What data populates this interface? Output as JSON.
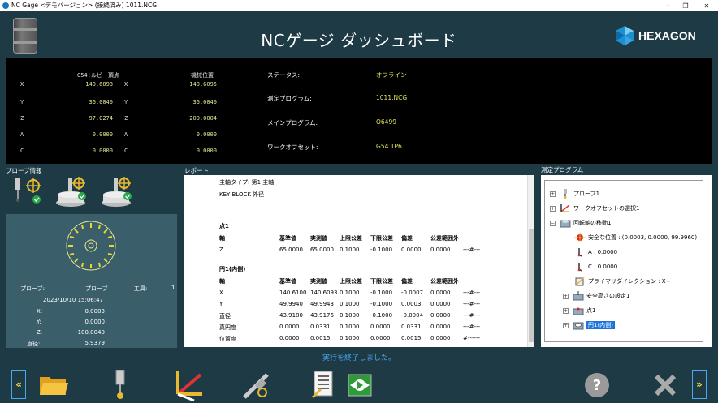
{
  "window": {
    "title": "NC Gage <デモバージョン> (接続済み) 1011.NCG",
    "min": "─",
    "max": "❐",
    "close": "✕"
  },
  "header": {
    "title": "NCゲージ ダッシュボード",
    "brand": "HEXAGON"
  },
  "dro": {
    "col1_header": "G54:ルビー頂点",
    "col2_header": "機械位置",
    "rows": [
      {
        "axis": "X",
        "v1": "140.6098",
        "axis2": "X",
        "v2": "140.6095"
      },
      {
        "axis": "Y",
        "v1": "36.0040",
        "axis2": "Y",
        "v2": "36.0040"
      },
      {
        "axis": "Z",
        "v1": "97.0274",
        "axis2": "Z",
        "v2": "200.0004"
      },
      {
        "axis": "A",
        "v1": "0.0000",
        "axis2": "A",
        "v2": "0.0000"
      },
      {
        "axis": "C",
        "v1": "0.0000",
        "axis2": "C",
        "v2": "0.0000"
      }
    ],
    "status": [
      {
        "label": "ステータス:",
        "value": "オフライン"
      },
      {
        "label": "測定プログラム:",
        "value": "1011.NCG"
      },
      {
        "label": "メインプログラム:",
        "value": "O6499"
      },
      {
        "label": "ワークオフセット:",
        "value": "G54.1P6"
      }
    ]
  },
  "sections": {
    "probe_info": "プローブ情報",
    "report": "レポート",
    "program": "測定プログラム"
  },
  "probe_info": {
    "probe_label": "プローブ:",
    "probe_value": "プローブ",
    "tool_label": "工具:",
    "tool_value": "1",
    "datetime": "2023/10/10 15:06:47",
    "x_label": "X:",
    "x_value": "0.0003",
    "y_label": "Y:",
    "y_value": "0.0000",
    "z_label": "Z:",
    "z_value": "-100.0040",
    "dia_label": "直径:",
    "dia_value": "5.9379"
  },
  "report": {
    "line1": "主軸タイプ: 第1 主軸",
    "line2": "KEY BLOCK 外径",
    "sec1_title": "点1",
    "sec2_title": "円1(内側)",
    "headers": [
      "軸",
      "基準値",
      "実測値",
      "上限公差",
      "下限公差",
      "偏差",
      "公差範囲外"
    ],
    "sec1_rows": [
      [
        "Z",
        "65.0000",
        "65.0000",
        "0.1000",
        "-0.1000",
        "0.0000",
        "0.0000",
        "---#---"
      ]
    ],
    "sec2_rows": [
      [
        "X",
        "140.6100",
        "140.6093",
        "0.1000",
        "-0.1000",
        "-0.0007",
        "0.0000",
        "---#---"
      ],
      [
        "Y",
        "49.9940",
        "49.9943",
        "0.1000",
        "-0.1000",
        "0.0003",
        "0.0000",
        "---#---"
      ],
      [
        "直径",
        "43.9180",
        "43.9176",
        "0.1000",
        "-0.1000",
        "-0.0004",
        "0.0000",
        "---#---"
      ],
      [
        "真円度",
        "0.0000",
        "0.0331",
        "0.1000",
        "0.0000",
        "0.0331",
        "0.0000",
        "---#---"
      ],
      [
        "位置度",
        "0.0000",
        "0.0015",
        "0.1000",
        "0.0000",
        "0.0015",
        "0.0000",
        "#------"
      ]
    ]
  },
  "tree": {
    "items": [
      {
        "label": "プローブ1",
        "expander": "+"
      },
      {
        "label": "ワークオフセットの選択1",
        "expander": "+"
      },
      {
        "label": "回転軸の移動1",
        "expander": "−"
      },
      {
        "label": "安全な位置 : (0.0003, 0.0000, 99.9960)"
      },
      {
        "label": "A : 0.0000"
      },
      {
        "label": "C : 0.0000"
      },
      {
        "label": "プライマリダイレクション : X+"
      },
      {
        "label": "安全高さの設定1",
        "expander": "+"
      },
      {
        "label": "点1",
        "expander": "+"
      },
      {
        "label": "円1(内側)",
        "expander": "+"
      }
    ]
  },
  "status_message": "実行を終了しました。",
  "toolbar": {
    "prev": "«",
    "next": "»",
    "help": "?"
  },
  "colors": {
    "bg": "#1d3a45",
    "accent": "#4aa8f0",
    "yellow": "#e6e85a",
    "selected": "#1e73d8"
  }
}
